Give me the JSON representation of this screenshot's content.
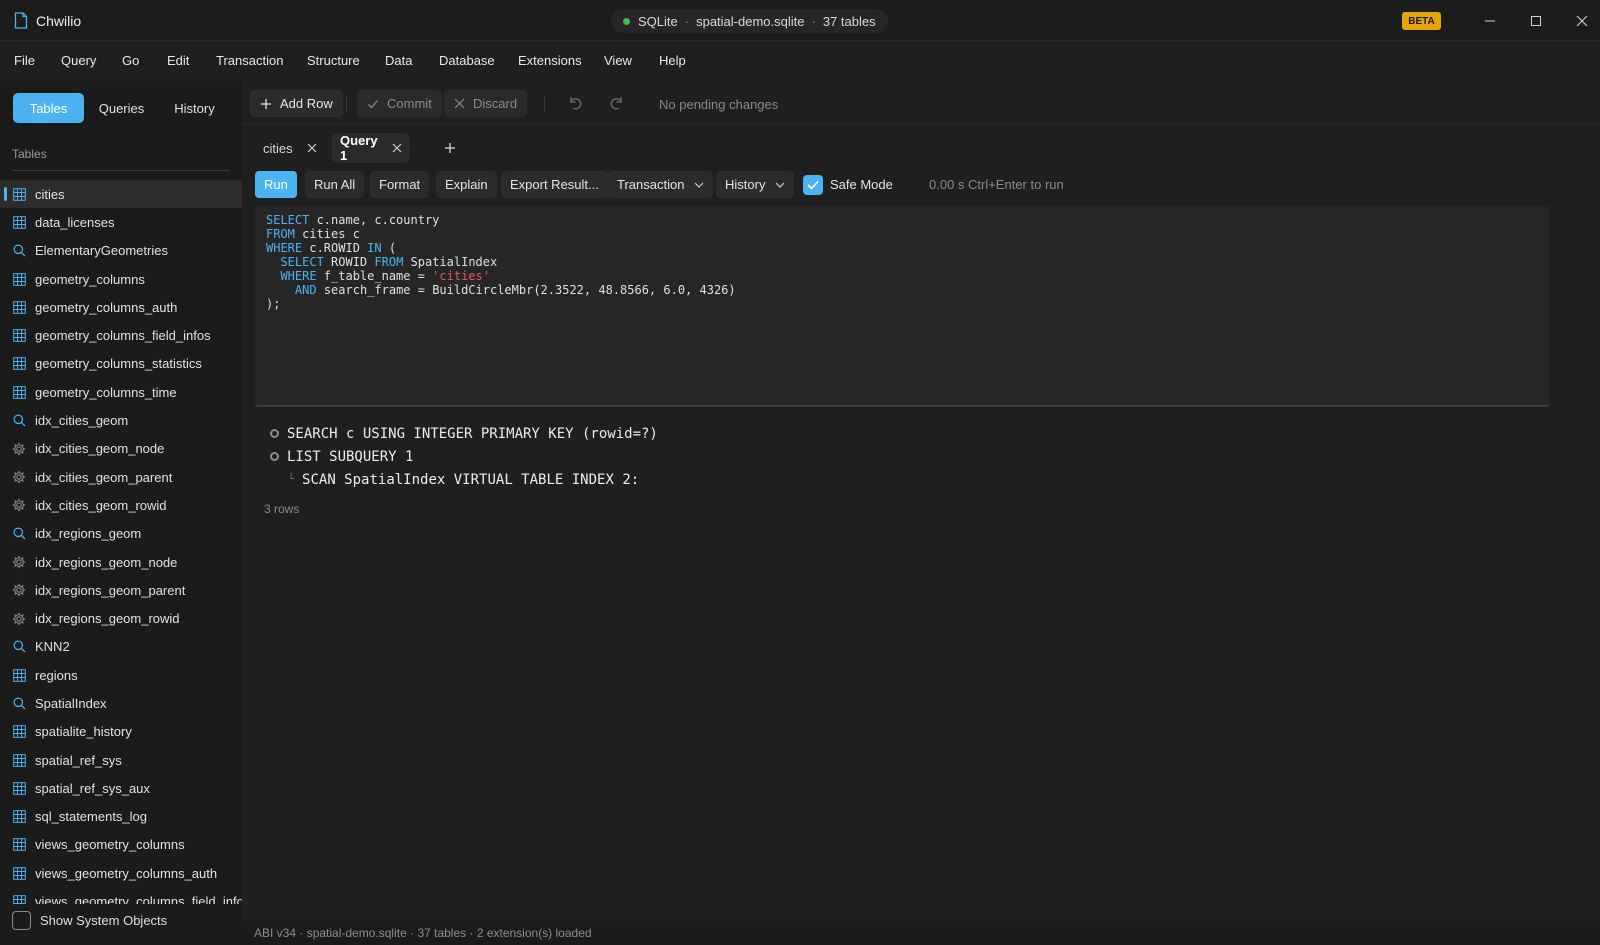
{
  "app": {
    "name": "Chwilio",
    "icon": "document-icon",
    "beta_badge": "BETA"
  },
  "connection": {
    "engine": "SQLite",
    "database": "spatial-demo.sqlite",
    "table_count": "37 tables",
    "status_color": "#3fb950"
  },
  "window_controls": [
    "minimize-icon",
    "maximize-icon",
    "close-icon"
  ],
  "menu": [
    "File",
    "Query",
    "Go",
    "Edit",
    "Transaction",
    "Structure",
    "Data",
    "Database",
    "Extensions",
    "View",
    "Help"
  ],
  "sidebar": {
    "tabs": [
      "Tables",
      "Queries",
      "History"
    ],
    "active_tab": "Tables",
    "section_label": "Tables",
    "items": [
      {
        "label": "cities",
        "icon": "table-icon",
        "selected": true
      },
      {
        "label": "data_licenses",
        "icon": "table-icon"
      },
      {
        "label": "ElementaryGeometries",
        "icon": "search-icon"
      },
      {
        "label": "geometry_columns",
        "icon": "table-icon"
      },
      {
        "label": "geometry_columns_auth",
        "icon": "table-icon"
      },
      {
        "label": "geometry_columns_field_infos",
        "icon": "table-icon"
      },
      {
        "label": "geometry_columns_statistics",
        "icon": "table-icon"
      },
      {
        "label": "geometry_columns_time",
        "icon": "table-icon"
      },
      {
        "label": "idx_cities_geom",
        "icon": "search-icon"
      },
      {
        "label": "idx_cities_geom_node",
        "icon": "gear-icon"
      },
      {
        "label": "idx_cities_geom_parent",
        "icon": "gear-icon"
      },
      {
        "label": "idx_cities_geom_rowid",
        "icon": "gear-icon"
      },
      {
        "label": "idx_regions_geom",
        "icon": "search-icon"
      },
      {
        "label": "idx_regions_geom_node",
        "icon": "gear-icon"
      },
      {
        "label": "idx_regions_geom_parent",
        "icon": "gear-icon"
      },
      {
        "label": "idx_regions_geom_rowid",
        "icon": "gear-icon"
      },
      {
        "label": "KNN2",
        "icon": "search-icon"
      },
      {
        "label": "regions",
        "icon": "table-icon"
      },
      {
        "label": "SpatialIndex",
        "icon": "search-icon"
      },
      {
        "label": "spatialite_history",
        "icon": "table-icon"
      },
      {
        "label": "spatial_ref_sys",
        "icon": "table-icon"
      },
      {
        "label": "spatial_ref_sys_aux",
        "icon": "table-icon"
      },
      {
        "label": "sql_statements_log",
        "icon": "table-icon"
      },
      {
        "label": "views_geometry_columns",
        "icon": "table-icon"
      },
      {
        "label": "views_geometry_columns_auth",
        "icon": "table-icon"
      },
      {
        "label": "views_geometry_columns_field_info",
        "icon": "table-icon"
      }
    ],
    "show_system_objects": {
      "label": "Show System Objects",
      "checked": false
    }
  },
  "toolbar": {
    "add_row": "Add Row",
    "commit": "Commit",
    "discard": "Discard",
    "pending": "No pending changes"
  },
  "tabs": [
    {
      "label": "cities",
      "active": false
    },
    {
      "label": "Query 1",
      "active": true
    }
  ],
  "query_bar": {
    "run": "Run",
    "run_all": "Run All",
    "format": "Format",
    "explain": "Explain",
    "export": "Export Result...",
    "transaction": "Transaction",
    "history": "History",
    "safe_mode": {
      "label": "Safe Mode",
      "checked": true
    },
    "elapsed": "0.00 s",
    "hint": "Ctrl+Enter to run"
  },
  "editor": {
    "lines": [
      "SELECT c.name, c.country",
      "FROM cities c",
      "WHERE c.ROWID IN (",
      "  SELECT ROWID FROM SpatialIndex",
      "  WHERE f_table_name = 'cities'",
      "    AND search_frame = BuildCircleMbr(2.3522, 48.8566, 6.0, 4326)",
      ");"
    ]
  },
  "plan": {
    "rows": [
      {
        "text": "SEARCH c USING INTEGER PRIMARY KEY (rowid=?)",
        "level": 0
      },
      {
        "text": "LIST SUBQUERY 1",
        "level": 0
      },
      {
        "text": "SCAN SpatialIndex VIRTUAL TABLE INDEX 2:",
        "level": 1
      }
    ],
    "row_count": "3 rows"
  },
  "statusbar": {
    "items": [
      "ABI v34",
      "spatial-demo.sqlite",
      "37 tables",
      "2 extension(s) loaded"
    ]
  },
  "colors": {
    "accent": "#4cb3f0",
    "background": "#1f1f1f",
    "beta": "#e5a50a",
    "string": "#e05a5a"
  }
}
